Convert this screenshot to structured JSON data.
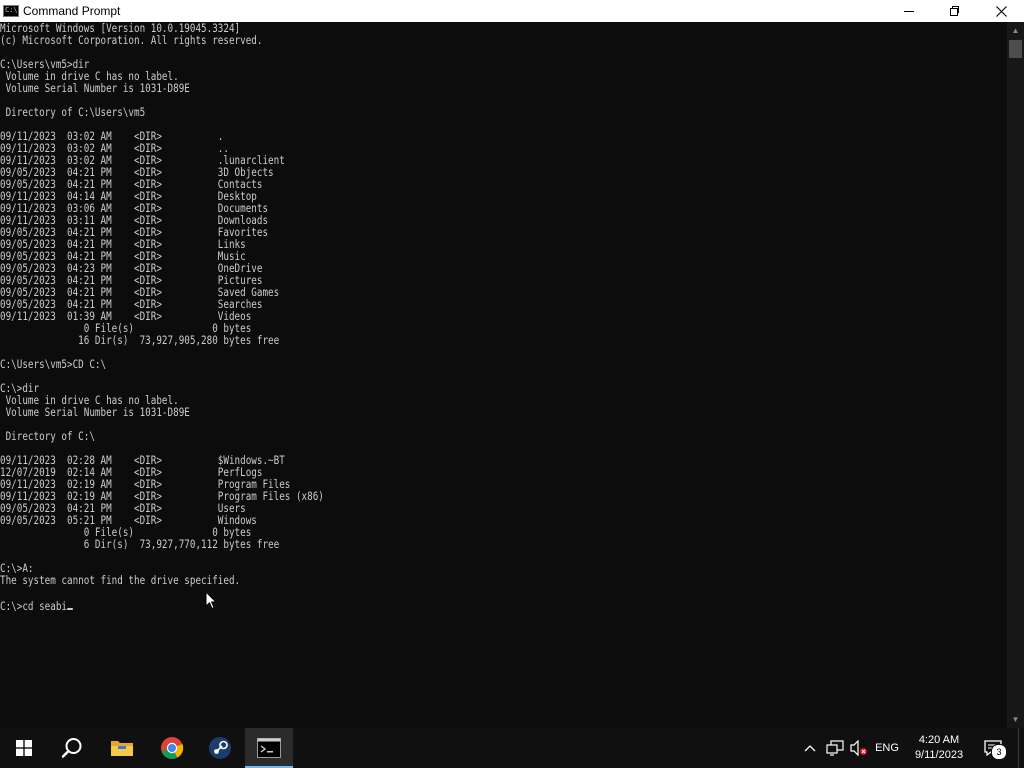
{
  "window": {
    "title": "Command Prompt",
    "icon_name": "cmd-icon",
    "icon_text": "C:\\"
  },
  "console": {
    "lines": [
      "Microsoft Windows [Version 10.0.19045.3324]",
      "(c) Microsoft Corporation. All rights reserved.",
      "",
      "C:\\Users\\vm5>dir",
      " Volume in drive C has no label.",
      " Volume Serial Number is 1031-D89E",
      "",
      " Directory of C:\\Users\\vm5",
      "",
      "09/11/2023  03:02 AM    <DIR>          .",
      "09/11/2023  03:02 AM    <DIR>          ..",
      "09/11/2023  03:02 AM    <DIR>          .lunarclient",
      "09/05/2023  04:21 PM    <DIR>          3D Objects",
      "09/05/2023  04:21 PM    <DIR>          Contacts",
      "09/11/2023  04:14 AM    <DIR>          Desktop",
      "09/11/2023  03:06 AM    <DIR>          Documents",
      "09/11/2023  03:11 AM    <DIR>          Downloads",
      "09/05/2023  04:21 PM    <DIR>          Favorites",
      "09/05/2023  04:21 PM    <DIR>          Links",
      "09/05/2023  04:21 PM    <DIR>          Music",
      "09/05/2023  04:23 PM    <DIR>          OneDrive",
      "09/05/2023  04:21 PM    <DIR>          Pictures",
      "09/05/2023  04:21 PM    <DIR>          Saved Games",
      "09/05/2023  04:21 PM    <DIR>          Searches",
      "09/11/2023  01:39 AM    <DIR>          Videos",
      "               0 File(s)              0 bytes",
      "              16 Dir(s)  73,927,905,280 bytes free",
      "",
      "C:\\Users\\vm5>CD C:\\",
      "",
      "C:\\>dir",
      " Volume in drive C has no label.",
      " Volume Serial Number is 1031-D89E",
      "",
      " Directory of C:\\",
      "",
      "09/11/2023  02:28 AM    <DIR>          $Windows.~BT",
      "12/07/2019  02:14 AM    <DIR>          PerfLogs",
      "09/11/2023  02:19 AM    <DIR>          Program Files",
      "09/11/2023  02:19 AM    <DIR>          Program Files (x86)",
      "09/05/2023  04:21 PM    <DIR>          Users",
      "09/05/2023  05:21 PM    <DIR>          Windows",
      "               0 File(s)              0 bytes",
      "               6 Dir(s)  73,927,770,112 bytes free",
      "",
      "C:\\>A:",
      "The system cannot find the drive specified.",
      ""
    ],
    "input_line": "C:\\>cd seabi"
  },
  "taskbar": {
    "pinned": [
      {
        "name": "start",
        "icon": "windows-logo-icon"
      },
      {
        "name": "search",
        "icon": "search-icon"
      },
      {
        "name": "file-explorer",
        "icon": "folder-icon"
      },
      {
        "name": "chrome",
        "icon": "chrome-icon"
      },
      {
        "name": "steam",
        "icon": "steam-icon"
      },
      {
        "name": "command-prompt",
        "icon": "cmd-icon",
        "active": true
      }
    ],
    "tray": {
      "language": "ENG",
      "time": "4:20 AM",
      "date": "9/11/2023",
      "notification_count": "3"
    }
  },
  "colors": {
    "console_bg": "#0c0c0c",
    "console_fg": "#cccccc",
    "taskbar_bg": "#101010",
    "accent": "#76b9ed"
  }
}
